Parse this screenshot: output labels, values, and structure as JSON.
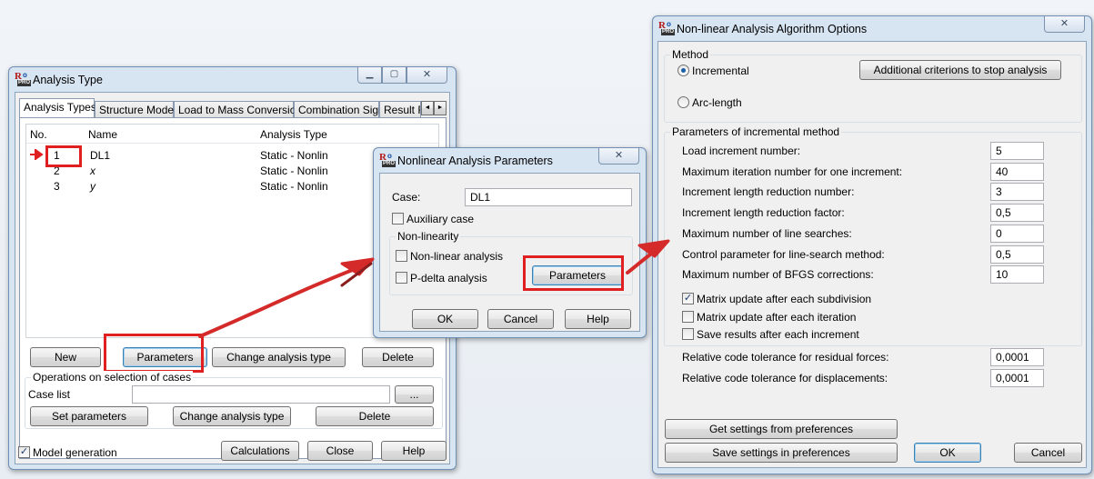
{
  "analysis_type": {
    "title": "Analysis Type",
    "tabs": [
      "Analysis Types",
      "Structure Model",
      "Load to Mass Conversion",
      "Combination Sign",
      "Result F"
    ],
    "columns": [
      "No.",
      "Name",
      "Analysis Type"
    ],
    "rows": [
      {
        "no": "1",
        "name": "DL1",
        "type": "Static - Nonlin"
      },
      {
        "no": "2",
        "name": "x",
        "type": "Static - Nonlin"
      },
      {
        "no": "3",
        "name": "y",
        "type": "Static - Nonlin"
      }
    ],
    "buttons": {
      "new": "New",
      "parameters": "Parameters",
      "change": "Change analysis type",
      "delete": "Delete"
    },
    "operations": {
      "title": "Operations on selection of cases",
      "case_list_label": "Case list",
      "case_list_value": "",
      "browse": "...",
      "set_parameters": "Set parameters",
      "change": "Change analysis type",
      "delete": "Delete"
    },
    "model_generation": "Model generation",
    "footer": {
      "calculations": "Calculations",
      "close": "Close",
      "help": "Help"
    }
  },
  "nonlinear_params": {
    "title": "Nonlinear Analysis Parameters",
    "case_label": "Case:",
    "case_value": "DL1",
    "auxiliary": "Auxiliary case",
    "group_title": "Non-linearity",
    "nonlinear": "Non-linear analysis",
    "pdelta": "P-delta analysis",
    "parameters": "Parameters",
    "ok": "OK",
    "cancel": "Cancel",
    "help": "Help"
  },
  "algorithm": {
    "title": "Non-linear Analysis Algorithm Options",
    "method_title": "Method",
    "incremental": "Incremental",
    "arc_length": "Arc-length",
    "additional": "Additional criterions to stop analysis",
    "params_title": "Parameters of incremental method",
    "params": [
      {
        "label": "Load increment number:",
        "value": "5"
      },
      {
        "label": "Maximum iteration number for one increment:",
        "value": "40"
      },
      {
        "label": "Increment length reduction number:",
        "value": "3"
      },
      {
        "label": "Increment length reduction factor:",
        "value": "0,5"
      },
      {
        "label": "Maximum number of line searches:",
        "value": "0"
      },
      {
        "label": "Control parameter for line-search method:",
        "value": "0,5"
      },
      {
        "label": "Maximum number of BFGS corrections:",
        "value": "10"
      }
    ],
    "checks": {
      "matrix_subdivision": "Matrix update after each subdivision",
      "matrix_iteration": "Matrix update after each iteration",
      "save_results": "Save results after each increment"
    },
    "tolerances": [
      {
        "label": "Relative code tolerance for residual forces:",
        "value": "0,0001"
      },
      {
        "label": "Relative code tolerance for displacements:",
        "value": "0,0001"
      }
    ],
    "buttons": {
      "get": "Get settings from preferences",
      "save": "Save settings in preferences",
      "ok": "OK",
      "cancel": "Cancel"
    }
  },
  "glyphs": {
    "minimize": "▁",
    "maximize": "▢",
    "close": "✕",
    "check": "✓",
    "tab_left": "◄",
    "tab_right": "►",
    "icon_r": "R",
    "icon_pro": "PRO",
    "icon_sup": "o"
  },
  "colors": {
    "highlight": "#e02020",
    "arrow": "#d42a2a",
    "title_bg": "#d7e4f2"
  }
}
